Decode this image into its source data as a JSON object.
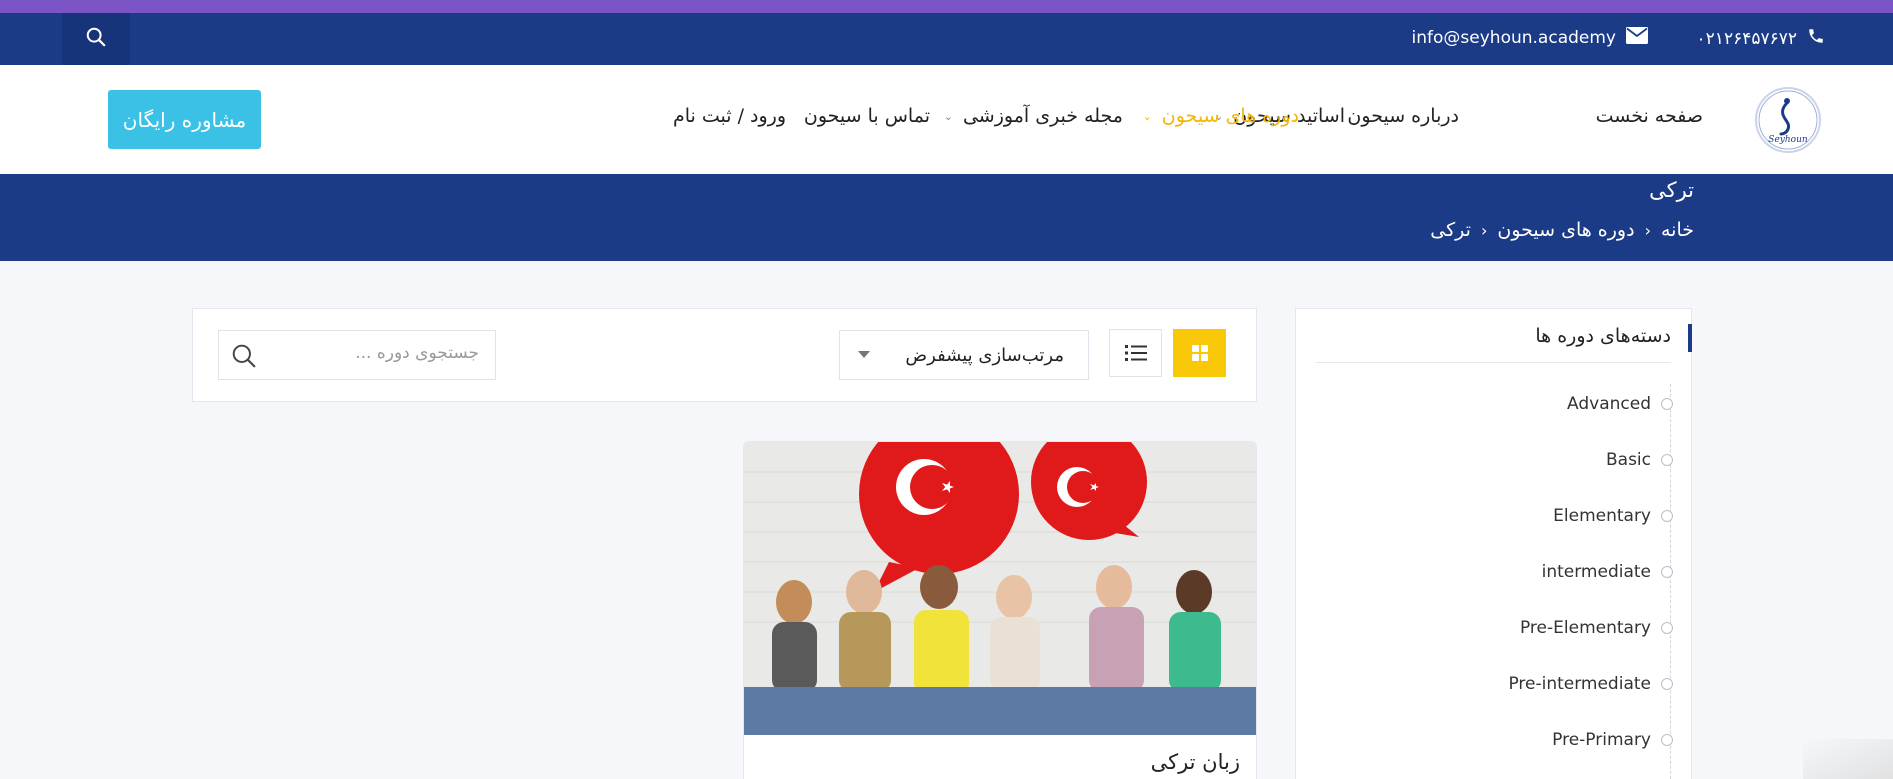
{
  "topbar": {
    "phone": "۰۲۱۲۶۴۵۷۶۷۲",
    "email": "info@seyhoun.academy"
  },
  "nav": {
    "logo_text": "Seyhoun",
    "items": [
      {
        "label": "صفحه نخست",
        "dropdown": false,
        "active": false
      },
      {
        "label": "درباره سیحون",
        "dropdown": false,
        "active": false
      },
      {
        "label": "اساتید سیحون",
        "dropdown": true,
        "active": false
      },
      {
        "label": "دوره های سیحون",
        "dropdown": true,
        "active": true
      },
      {
        "label": "مجله خبری آموزشی",
        "dropdown": true,
        "active": false
      },
      {
        "label": "تماس با سیحون",
        "dropdown": false,
        "active": false
      },
      {
        "label": "ورود / ثبت نام",
        "dropdown": false,
        "active": false
      }
    ],
    "consult_button": "مشاوره رایگان"
  },
  "banner": {
    "title": "ترکی",
    "breadcrumb": [
      "خانه",
      "دوره های سیحون",
      "ترکی"
    ]
  },
  "sidebar": {
    "title": "دسته‌های دوره ها",
    "categories": [
      "Advanced",
      "Basic",
      "Elementary",
      "intermediate",
      "Pre-Elementary",
      "Pre-intermediate",
      "Pre-Primary"
    ]
  },
  "filter": {
    "sort_label": "مرتب‌سازی پیشفرض",
    "search_placeholder": "جستجوی دوره ..."
  },
  "course": {
    "title": "زبان ترکی"
  },
  "colors": {
    "primary": "#1b3b87",
    "accent": "#f2b705",
    "button": "#3bc1e6",
    "grid_button": "#f9c808",
    "top_strip": "#7b55c6"
  }
}
